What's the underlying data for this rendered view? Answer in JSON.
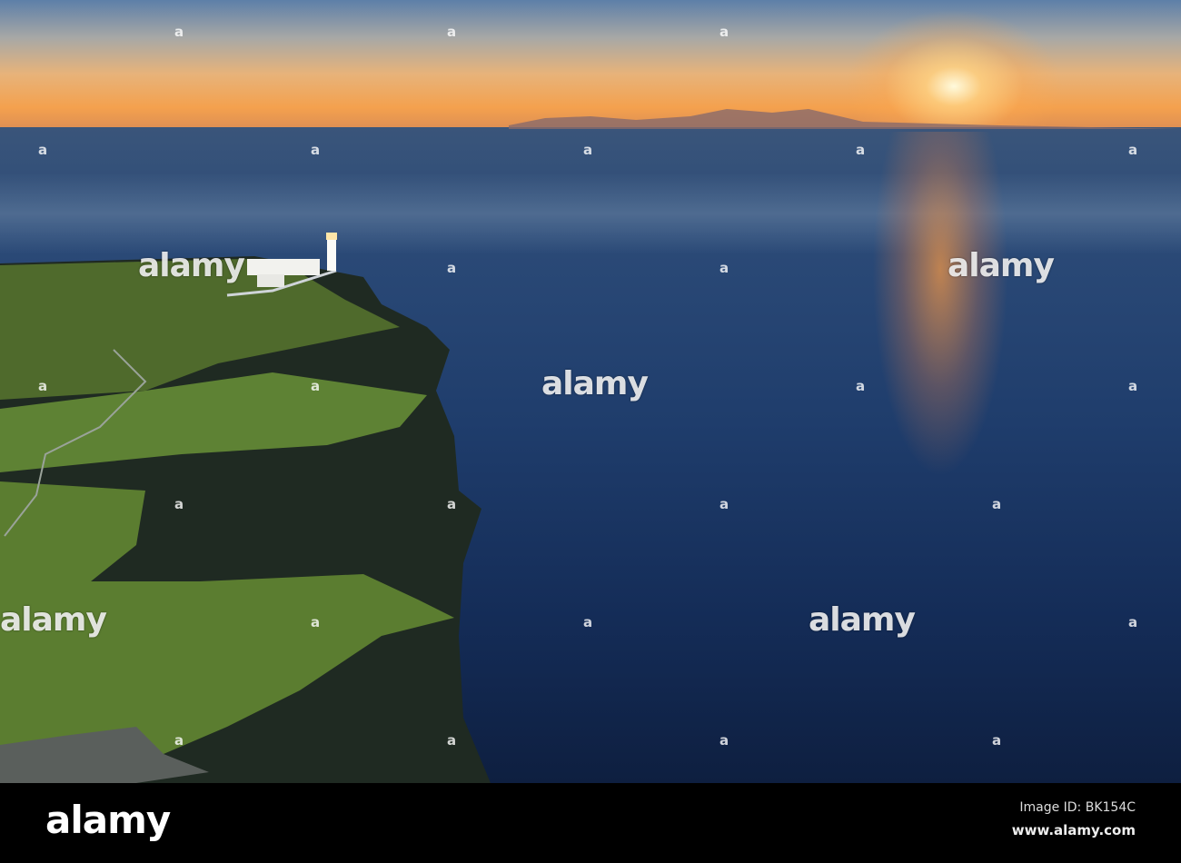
{
  "watermark": {
    "text": "alamy",
    "small_mark": "a"
  },
  "footer": {
    "logo": "alamy",
    "image_id": "Image ID: BK154C",
    "url": "www.alamy.com"
  },
  "colors": {
    "sky_top": "#5d7fa8",
    "sky_horizon": "#f4a14e",
    "sea": "#1f3d6c",
    "grass": "#5b7a2e",
    "cliff": "#1e2a22"
  }
}
